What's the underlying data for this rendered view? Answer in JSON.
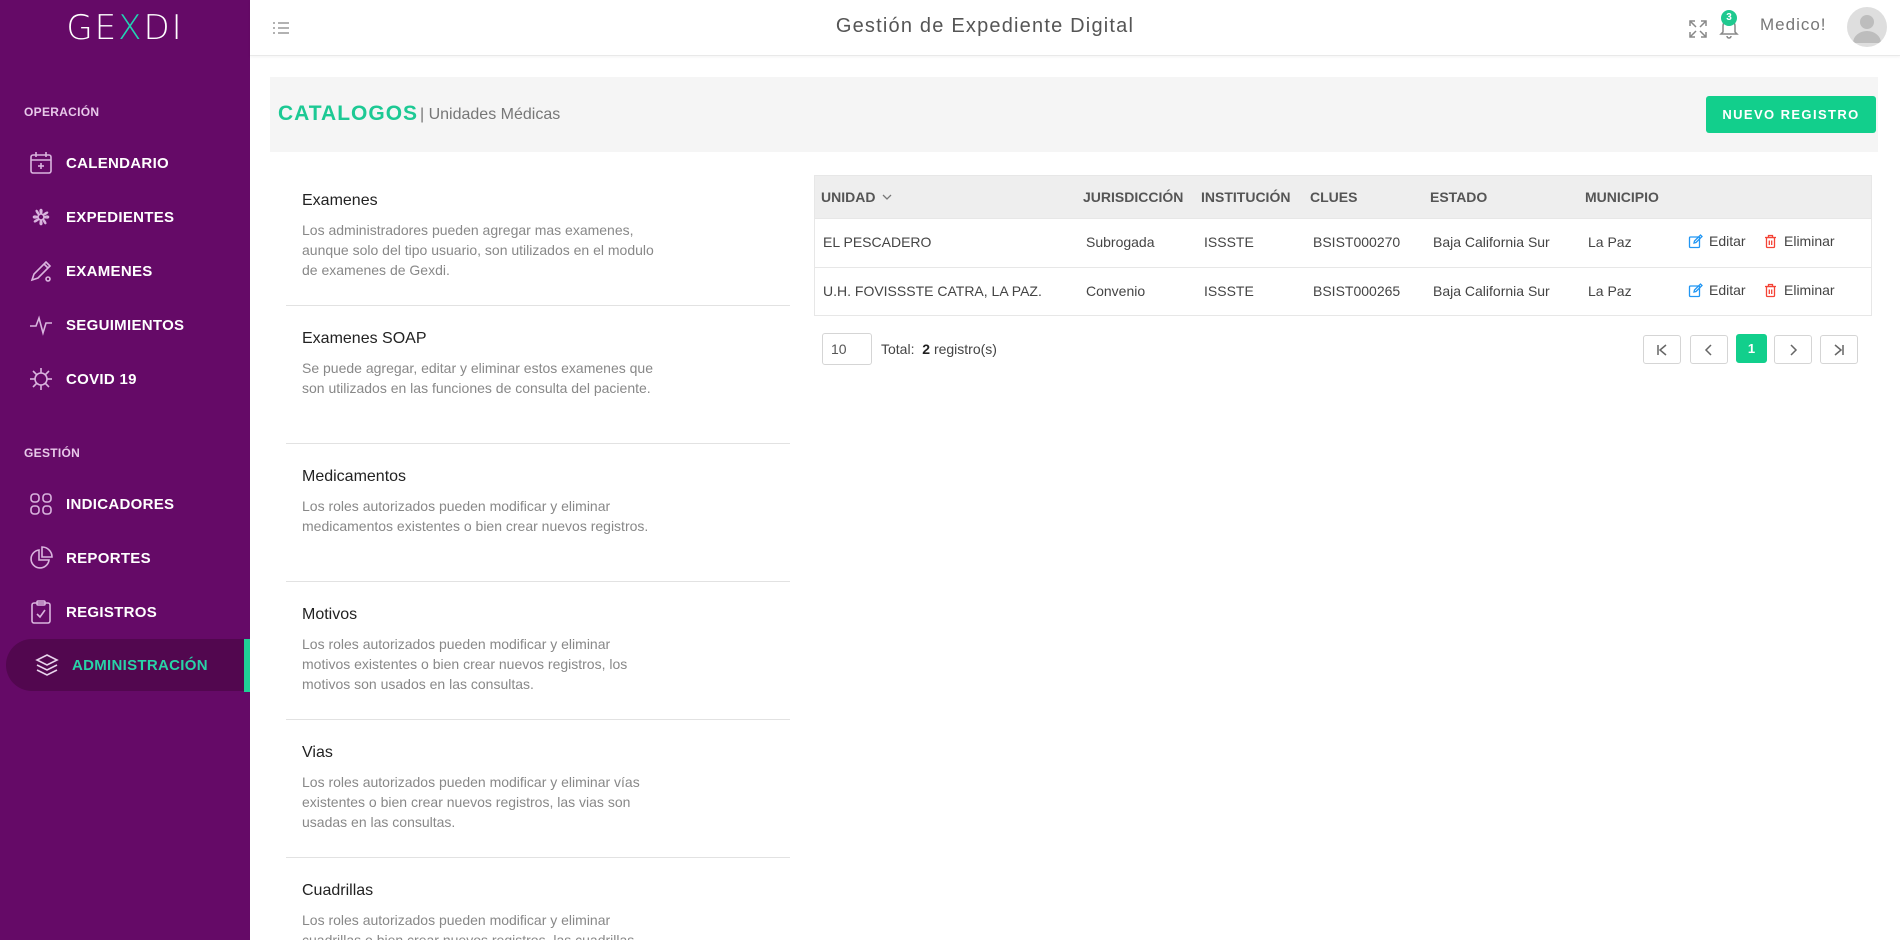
{
  "app": {
    "logo_text_left": "GE",
    "logo_text_mid": "X",
    "logo_text_right": "DI",
    "title": "Gestión de Expediente Digital",
    "user_name": "Medico!",
    "notification_count": "3"
  },
  "colors": {
    "sidebar": "#650a67",
    "accent": "#12cf8c",
    "active_label": "#28d3a7"
  },
  "sidebar": {
    "section_operacion": "OPERACIÓN",
    "section_gestion": "GESTIÓN",
    "items": [
      {
        "label": "CALENDARIO",
        "icon": "calendar-icon"
      },
      {
        "label": "EXPEDIENTES",
        "icon": "flower-icon"
      },
      {
        "label": "EXAMENES",
        "icon": "pencil-icon"
      },
      {
        "label": "SEGUIMIENTOS",
        "icon": "pulse-icon"
      },
      {
        "label": "COVID 19",
        "icon": "virus-icon"
      },
      {
        "label": "INDICADORES",
        "icon": "grid-icon"
      },
      {
        "label": "REPORTES",
        "icon": "pie-icon"
      },
      {
        "label": "REGISTROS",
        "icon": "clipboard-icon"
      },
      {
        "label": "ADMINISTRACIÓN",
        "icon": "layers-icon",
        "active": true
      }
    ]
  },
  "page": {
    "title": "CATALOGOS",
    "subtitle": "| Unidades Médicas",
    "new_button": "NUEVO REGISTRO"
  },
  "catalogs": [
    {
      "name": "Examenes",
      "desc": "Los administradores pueden agregar mas examenes, aunque solo del tipo usuario, son utilizados en el modulo de examenes de Gexdi."
    },
    {
      "name": "Examenes SOAP",
      "desc": "Se puede agregar, editar y eliminar estos examenes que son utilizados en las funciones de consulta del paciente."
    },
    {
      "name": "Medicamentos",
      "desc": "Los roles autorizados pueden modificar y eliminar medicamentos existentes o bien crear nuevos registros."
    },
    {
      "name": "Motivos",
      "desc": "Los roles autorizados pueden modificar y eliminar motivos existentes o bien crear nuevos registros, los motivos son usados en las consultas."
    },
    {
      "name": "Vias",
      "desc": "Los roles autorizados pueden modificar y eliminar vías existentes o bien crear nuevos registros, las vias son usadas en las consultas."
    },
    {
      "name": "Cuadrillas",
      "desc": "Los roles autorizados pueden modificar y eliminar cuadrillas o bien crear nuevos registros, las cuadrillas"
    }
  ],
  "table": {
    "columns": [
      "UNIDAD",
      "JURISDICCIÓN",
      "INSTITUCIÓN",
      "CLUES",
      "ESTADO",
      "MUNICIPIO"
    ],
    "rows": [
      [
        "EL PESCADERO",
        "Subrogada",
        "ISSSTE",
        "BSIST000270",
        "Baja California Sur",
        "La Paz"
      ],
      [
        "U.H. FOVISSSTE CATRA, LA PAZ.",
        "Convenio",
        "ISSSTE",
        "BSIST000265",
        "Baja California Sur",
        "La Paz"
      ]
    ],
    "edit_label": "Editar",
    "delete_label": "Eliminar"
  },
  "footer": {
    "page_size": "10",
    "total_prefix": "Total:",
    "total_count": "2",
    "total_suffix": "registro(s)",
    "current_page": "1"
  }
}
